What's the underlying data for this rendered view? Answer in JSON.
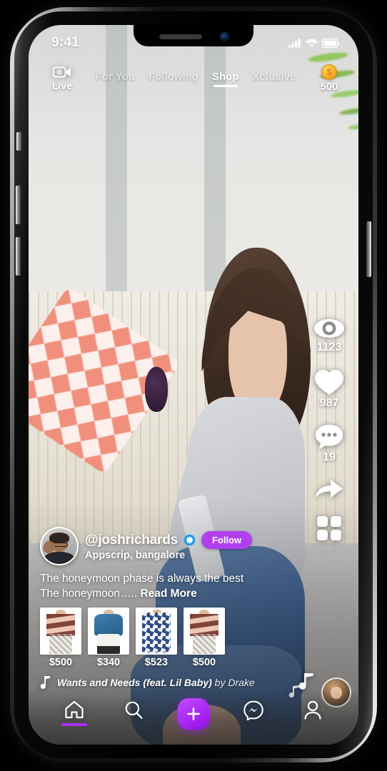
{
  "statusbar": {
    "time": "9:41",
    "signal_icon": "cellular-signal-icon",
    "wifi_icon": "wifi-icon",
    "battery_icon": "battery-full-icon"
  },
  "topnav": {
    "live": {
      "label": "Live",
      "icon": "live-camera-icon"
    },
    "tabs": [
      {
        "label": "For You",
        "active": false
      },
      {
        "label": "Following",
        "active": false
      },
      {
        "label": "Shop",
        "active": true
      },
      {
        "label": "Xclusive",
        "active": false
      }
    ],
    "coins": {
      "icon": "coin-icon",
      "symbol": "$",
      "count": "500"
    }
  },
  "rail": [
    {
      "name": "views",
      "icon": "eye-icon",
      "count": "1123"
    },
    {
      "name": "likes",
      "icon": "heart-icon",
      "count": "987"
    },
    {
      "name": "comments",
      "icon": "comment-bubble-icon",
      "count": "19"
    },
    {
      "name": "share",
      "icon": "share-arrow-icon",
      "count": ""
    },
    {
      "name": "grid",
      "icon": "grid-squares-icon",
      "count": ""
    }
  ],
  "post": {
    "username": "@joshrichards",
    "verified_icon": "verified-badge-icon",
    "follow_label": "Follow",
    "location": "Appscrip, bangalore",
    "caption_line1": "The honeymoon phase is always the best",
    "caption_line2": "The honeymoon…..",
    "read_more": "Read More",
    "avatar_icon": "user-avatar"
  },
  "products": [
    {
      "price": "$500",
      "art": "striped-sweater"
    },
    {
      "price": "$340",
      "art": "blue-sweater"
    },
    {
      "price": "$523",
      "art": "floral-dress"
    },
    {
      "price": "$500",
      "art": "striped-sweater"
    }
  ],
  "music": {
    "note_icon": "music-note-icon",
    "title": "Wants and Needs (feat. Lil Baby)",
    "by": " by Drake",
    "disc_icon": "rotating-album-disc"
  },
  "tabbar": [
    {
      "name": "home",
      "icon": "home-icon",
      "active": true
    },
    {
      "name": "search",
      "icon": "search-icon",
      "active": false
    },
    {
      "name": "create",
      "icon": "plus-icon",
      "active": false
    },
    {
      "name": "messages",
      "icon": "messenger-icon",
      "active": false
    },
    {
      "name": "profile",
      "icon": "person-icon",
      "active": false
    }
  ],
  "colors": {
    "accent_purple": "#a931f5",
    "follow_purple": "#b13ff0",
    "coin_gold": "#f5a623",
    "verified_blue": "#1d9bf0"
  }
}
